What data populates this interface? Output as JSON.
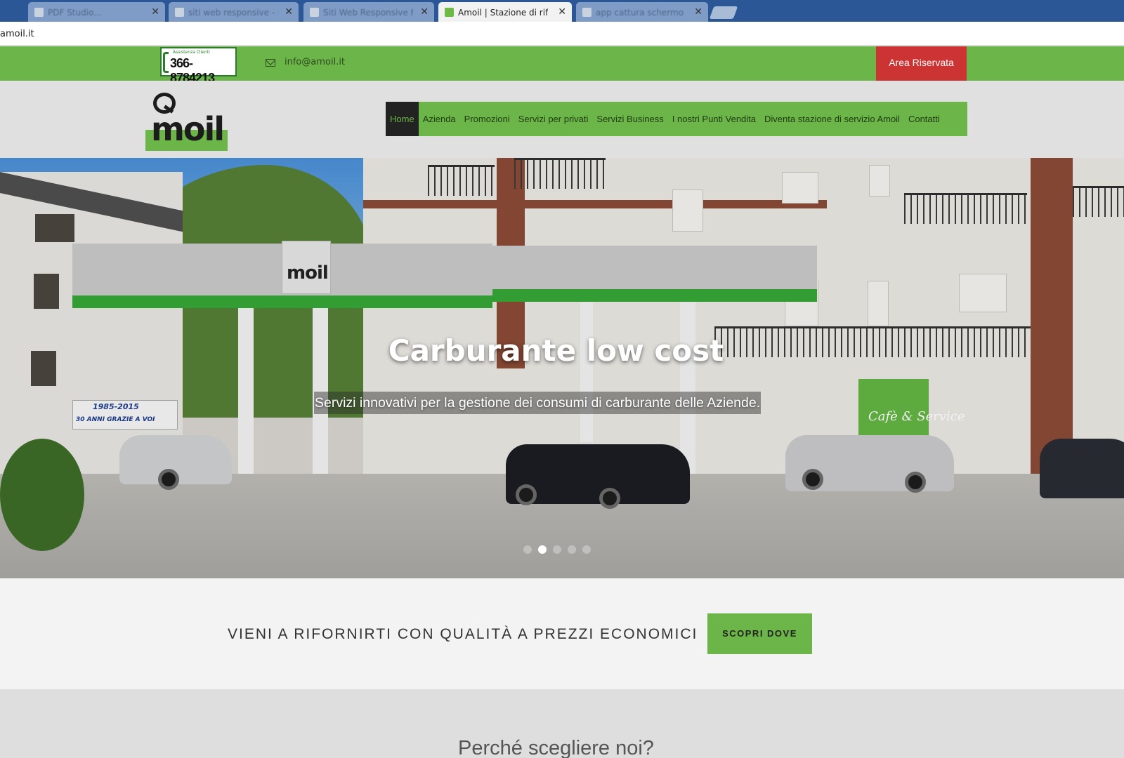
{
  "browser": {
    "tabs": [
      {
        "title": "PDF Studio...",
        "active": false
      },
      {
        "title": "siti web responsive - Go",
        "active": false
      },
      {
        "title": "Siti Web Responsive Fo",
        "active": false
      },
      {
        "title": "Amoil | Stazione di riforn",
        "active": true
      },
      {
        "title": "app cattura schermo ch",
        "active": false
      }
    ],
    "url": "amoil.it"
  },
  "topbar": {
    "phone_label": "Assistenza Clienti",
    "phone_number": "366-8784213",
    "email": "info@amoil.it",
    "area_button": "Area Riservata",
    "accent_color": "#6cb548",
    "area_color": "#cc3434"
  },
  "header": {
    "logo_text": "moil",
    "nav": [
      {
        "label": "Home",
        "active": true
      },
      {
        "label": "Azienda",
        "active": false
      },
      {
        "label": "Promozioni",
        "active": false
      },
      {
        "label": "Servizi per privati",
        "active": false
      },
      {
        "label": "Servizi Business",
        "active": false
      },
      {
        "label": "I nostri Punti Vendita",
        "active": false
      },
      {
        "label": "Diventa stazione di servizio Amoil",
        "active": false
      },
      {
        "label": "Contatti",
        "active": false
      }
    ]
  },
  "hero": {
    "title": "Carburante low cost",
    "subtitle": "Servizi innovativi per la gestione dei consumi di carburante delle Aziende.",
    "slides_count": 5,
    "active_slide": 2,
    "sign_years": "1985-2015",
    "sign_thanks": "30 ANNI GRAZIE A VOI",
    "cafe_text": "Cafè & Service"
  },
  "cta": {
    "text": "VIENI A RIFORNIRTI CON QUALITÀ A PREZZI ECONOMICI",
    "button": "SCOPRI DOVE"
  },
  "why": {
    "title": "Perché scegliere noi?"
  }
}
